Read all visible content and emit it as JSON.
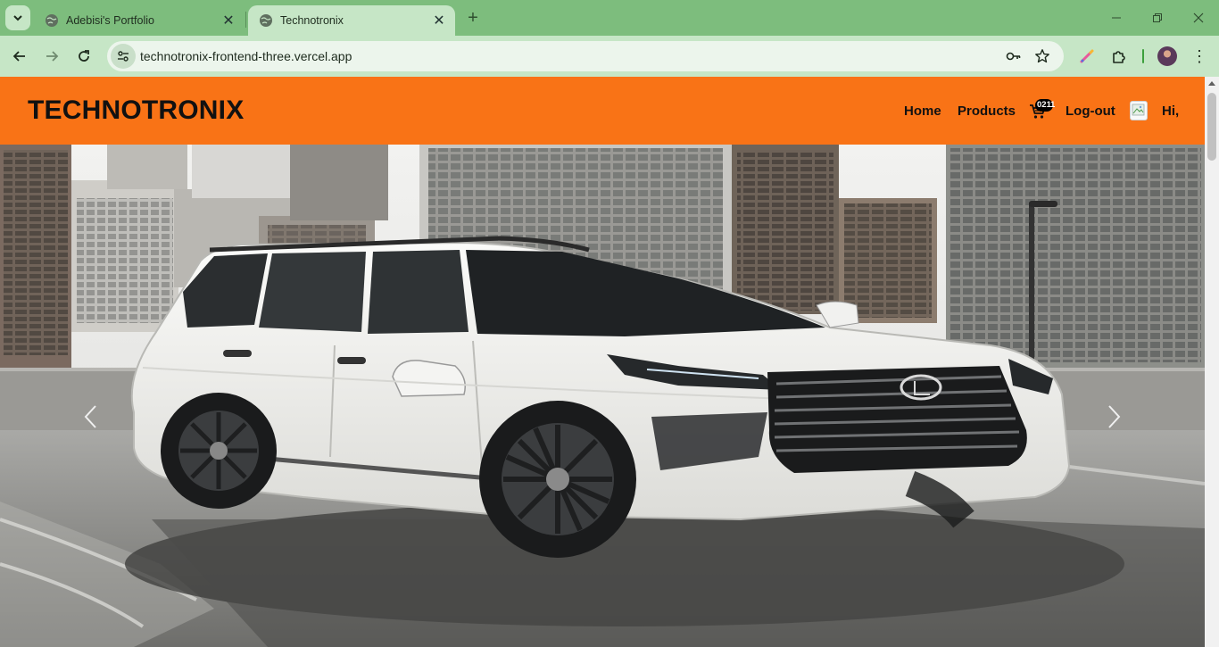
{
  "browser": {
    "tabs": [
      {
        "title": "Adebisi's Portfolio",
        "active": false
      },
      {
        "title": "Technotronix",
        "active": true
      }
    ],
    "url": "technotronix-frontend-three.vercel.app"
  },
  "site": {
    "logo": "TECHNOTRONIX",
    "nav": {
      "home": "Home",
      "products": "Products",
      "cart_count": "021",
      "cart_count_extra": "1",
      "logout": "Log-out",
      "greeting": "Hi,"
    },
    "colors": {
      "header": "#f97316",
      "text": "#111111"
    }
  },
  "hero": {
    "slide_subject": "white Lexus SUV on city rooftop",
    "controls": [
      "chevron-left-icon",
      "chevron-right-icon"
    ]
  }
}
